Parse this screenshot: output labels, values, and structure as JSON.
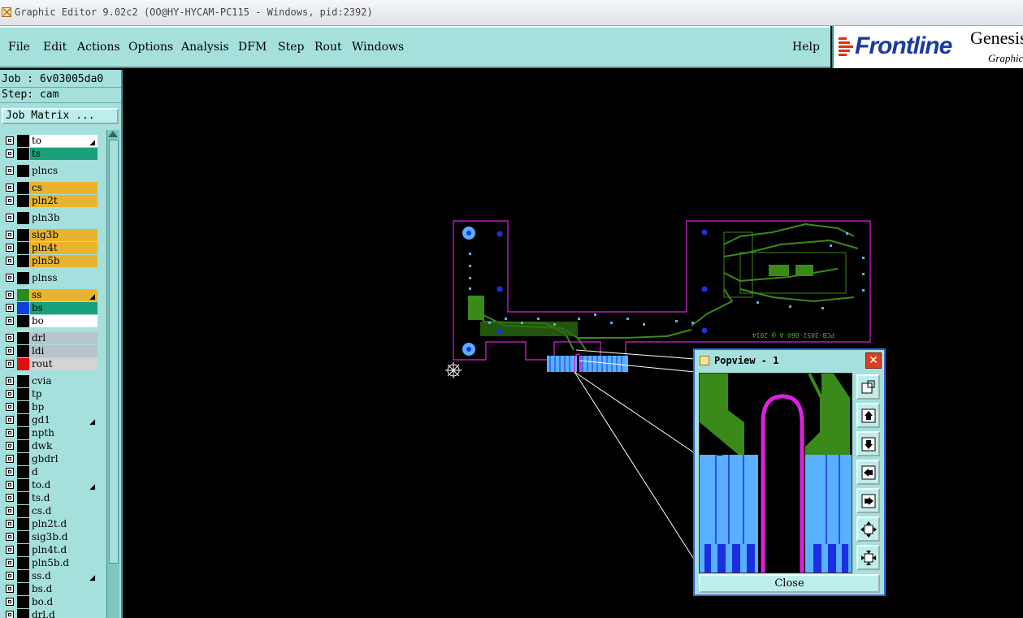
{
  "window": {
    "title": "Graphic Editor 9.02c2 (OO@HY-HYCAM-PC115 - Windows, pid:2392)"
  },
  "menu": {
    "items": [
      "File",
      "Edit",
      "Actions",
      "Options",
      "Analysis",
      "DFM",
      "Step",
      "Rout",
      "Windows"
    ],
    "help": "Help"
  },
  "logo": {
    "brand": "Frontline",
    "product": "Genesis",
    "subtitle": "Graphic"
  },
  "sidebar": {
    "job": "Job : 6v03005da0",
    "step": "Step: cam",
    "job_matrix": "Job Matrix ...",
    "layers": [
      {
        "name": "to",
        "bg": "#ffffff",
        "swatch": "#000000",
        "mark": true
      },
      {
        "name": "ts",
        "bg": "#1aa07a",
        "swatch": "#000000",
        "mark": false
      },
      {
        "name": "plncs",
        "bg": "#a6e0dc",
        "swatch": "#000000",
        "mark": false
      },
      {
        "name": "cs",
        "bg": "#e8b430",
        "swatch": "#000000",
        "mark": false
      },
      {
        "name": "pln2t",
        "bg": "#e8b430",
        "swatch": "#000000",
        "mark": false
      },
      {
        "name": "pln3b",
        "bg": "#a6e0dc",
        "swatch": "#000000",
        "mark": false
      },
      {
        "name": "sig3b",
        "bg": "#e8b430",
        "swatch": "#000000",
        "mark": false
      },
      {
        "name": "pln4t",
        "bg": "#e8b430",
        "swatch": "#000000",
        "mark": false
      },
      {
        "name": "pln5b",
        "bg": "#e8b430",
        "swatch": "#000000",
        "mark": false
      },
      {
        "name": "plnss",
        "bg": "#a6e0dc",
        "swatch": "#000000",
        "mark": false
      },
      {
        "name": "ss",
        "bg": "#e8b430",
        "swatch": "#2a8a1a",
        "mark": true
      },
      {
        "name": "bs",
        "bg": "#1aa07a",
        "swatch": "#1040e0",
        "mark": false
      },
      {
        "name": "bo",
        "bg": "#ffffff",
        "swatch": "#000000",
        "mark": false
      },
      {
        "name": "drl",
        "bg": "#b8c4cc",
        "swatch": "#000000",
        "mark": false
      },
      {
        "name": "ldi",
        "bg": "#b8c4cc",
        "swatch": "#000000",
        "mark": false
      },
      {
        "name": "rout",
        "bg": "#d4d4d4",
        "swatch": "#e01010",
        "mark": false
      },
      {
        "name": "cvia",
        "bg": "#a6e0dc",
        "swatch": "#000000",
        "mark": false
      },
      {
        "name": "tp",
        "bg": "#a6e0dc",
        "swatch": "#000000",
        "mark": false
      },
      {
        "name": "bp",
        "bg": "#a6e0dc",
        "swatch": "#000000",
        "mark": false
      },
      {
        "name": "gd1",
        "bg": "#a6e0dc",
        "swatch": "#000000",
        "mark": true
      },
      {
        "name": "npth",
        "bg": "#a6e0dc",
        "swatch": "#000000",
        "mark": false
      },
      {
        "name": "dwk",
        "bg": "#a6e0dc",
        "swatch": "#000000",
        "mark": false
      },
      {
        "name": "gbdrl",
        "bg": "#a6e0dc",
        "swatch": "#000000",
        "mark": false
      },
      {
        "name": "d",
        "bg": "#a6e0dc",
        "swatch": "#000000",
        "mark": false
      },
      {
        "name": "to.d",
        "bg": "#a6e0dc",
        "swatch": "#000000",
        "mark": true
      },
      {
        "name": "ts.d",
        "bg": "#a6e0dc",
        "swatch": "#000000",
        "mark": false
      },
      {
        "name": "cs.d",
        "bg": "#a6e0dc",
        "swatch": "#000000",
        "mark": false
      },
      {
        "name": "pln2t.d",
        "bg": "#a6e0dc",
        "swatch": "#000000",
        "mark": false
      },
      {
        "name": "sig3b.d",
        "bg": "#a6e0dc",
        "swatch": "#000000",
        "mark": false
      },
      {
        "name": "pln4t.d",
        "bg": "#a6e0dc",
        "swatch": "#000000",
        "mark": false
      },
      {
        "name": "pln5b.d",
        "bg": "#a6e0dc",
        "swatch": "#000000",
        "mark": false
      },
      {
        "name": "ss.d",
        "bg": "#a6e0dc",
        "swatch": "#000000",
        "mark": true
      },
      {
        "name": "bs.d",
        "bg": "#a6e0dc",
        "swatch": "#000000",
        "mark": false
      },
      {
        "name": "bo.d",
        "bg": "#a6e0dc",
        "swatch": "#000000",
        "mark": false
      },
      {
        "name": "drl.d",
        "bg": "#a6e0dc",
        "swatch": "#000000",
        "mark": false
      }
    ]
  },
  "popview": {
    "title": "Popview - 1",
    "close_label": "Close",
    "tools": [
      "zoom-window-icon",
      "pan-up-icon",
      "pan-down-icon",
      "pan-left-icon",
      "pan-right-icon",
      "zoom-in-icon",
      "zoom-out-icon"
    ]
  },
  "board": {
    "text": "PCB-3052-060-A @ 2014"
  },
  "colors": {
    "panel": "#a6e0dc",
    "trace": "#3a8a1a",
    "pad": "#1a30e0",
    "via": "#58b0ff",
    "outline": "#e020e0"
  }
}
